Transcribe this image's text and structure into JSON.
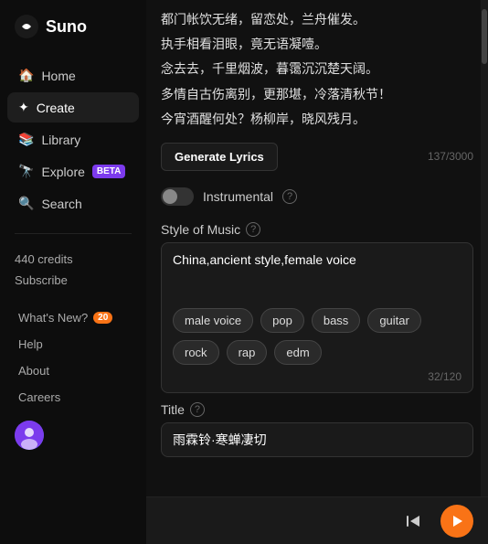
{
  "sidebar": {
    "logo_text": "Suno",
    "nav_items": [
      {
        "id": "home",
        "label": "Home",
        "active": false
      },
      {
        "id": "create",
        "label": "Create",
        "active": true
      },
      {
        "id": "library",
        "label": "Library",
        "active": false
      },
      {
        "id": "explore",
        "label": "Explore",
        "active": false,
        "badge": "BETA"
      },
      {
        "id": "search",
        "label": "Search",
        "active": false
      }
    ],
    "credits": "440 credits",
    "subscribe": "Subscribe",
    "bottom_items": [
      {
        "id": "whats-new",
        "label": "What's New?",
        "badge": "20"
      },
      {
        "id": "help",
        "label": "Help"
      },
      {
        "id": "about",
        "label": "About"
      },
      {
        "id": "careers",
        "label": "Careers"
      }
    ]
  },
  "main": {
    "lyrics": [
      "都门帐饮无绪，留恋处，兰舟催发。",
      "执手相看泪眼，竟无语凝噎。",
      "念去去，千里烟波，暮霭沉沉楚天阔。",
      "多情自古伤离别，更那堪，冷落清秋节！",
      "今宵酒醒何处？杨柳岸，晓风残月。"
    ],
    "generate_btn_label": "Generate Lyrics",
    "lyrics_char_count": "137/3000",
    "instrumental_label": "Instrumental",
    "style_section_label": "Style of Music",
    "style_text": "China,ancient style,female voice",
    "style_tags": [
      "male voice",
      "pop",
      "bass",
      "guitar",
      "rock",
      "rap",
      "edm"
    ],
    "style_char_count": "32/120",
    "title_label": "Title",
    "title_help": "?",
    "title_value": "雨霖铃·寒蝉凄切"
  }
}
